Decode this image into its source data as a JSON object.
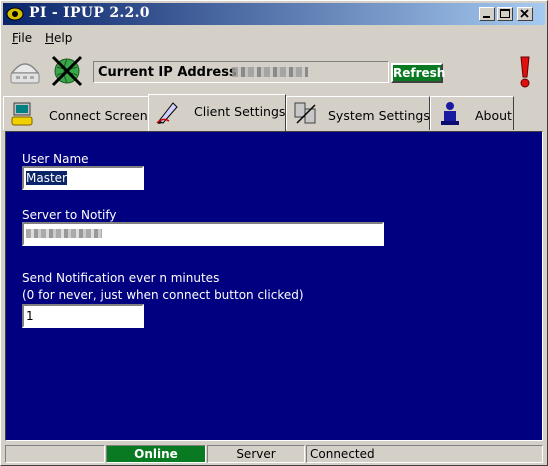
{
  "window": {
    "title": "PI - IPUP 2.2.0"
  },
  "menu": [
    {
      "label": "File",
      "ul": "F",
      "rest": "ile"
    },
    {
      "label": "Help",
      "ul": "H",
      "rest": "elp"
    }
  ],
  "toolbar": {
    "ip_label": "Current IP Address",
    "refresh_label": "Refresh"
  },
  "tabs": [
    {
      "label": "Connect Screen",
      "icon": "computer-phone-icon"
    },
    {
      "label": "Client Settings",
      "icon": "pen-icon",
      "active": true
    },
    {
      "label": "System Settings",
      "icon": "servers-icon"
    },
    {
      "label": "About",
      "icon": "person-icon"
    }
  ],
  "form": {
    "user_name_label": "User Name",
    "user_name_value": "Master",
    "server_label": "Server to Notify",
    "notify_label_line1": "Send Notification ever n minutes",
    "notify_label_line2": "(0 for never, just when connect button clicked)",
    "notify_value": "1"
  },
  "status": {
    "online": "Online",
    "server": "Server",
    "connected": "Connected"
  },
  "colors": {
    "panel_bg": "#000080",
    "online_green": "#0a7a22",
    "title_start": "#0a246a",
    "title_end": "#a6caf0"
  }
}
